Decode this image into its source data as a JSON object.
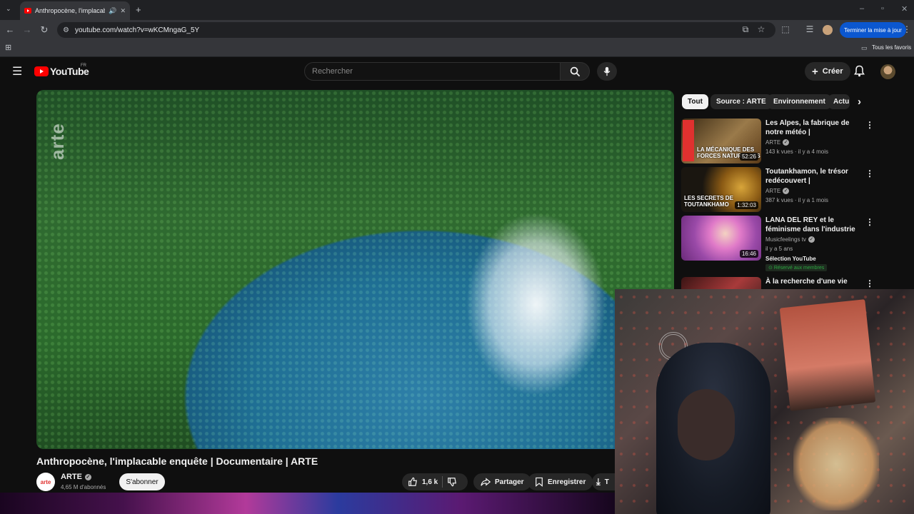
{
  "browser": {
    "tab_title": "Anthropocène, l'implacable",
    "url": "youtube.com/watch?v=wKCMngaG_5Y",
    "update_button": "Terminer la mise à jour",
    "bookmarks_label": "Tous les favoris"
  },
  "header": {
    "logo_text": "YouTube",
    "region": "FR",
    "search_placeholder": "Rechercher",
    "create_label": "Créer"
  },
  "video": {
    "watermark": "arte",
    "title": "Anthropocène, l'implacable enquête | Documentaire | ARTE",
    "channel_logo": "arte",
    "channel": "ARTE",
    "subscribers": "4,65 M d'abonnés",
    "subscribe": "S'abonner",
    "likes": "1,6 k",
    "share": "Partager",
    "save": "Enregistrer",
    "download_partial": "T"
  },
  "chips": [
    "Tout",
    "Source : ARTE",
    "Environnement",
    "Actu"
  ],
  "recommendations": [
    {
      "title": "Les Alpes, la fabrique de notre météo | Documentaire | ARTE",
      "channel": "ARTE",
      "meta": "143 k vues · il y a 4 mois",
      "duration": "52:26",
      "thumb_caption": "LA MÉCANIQUE DES FORCES NATURELLES",
      "thumb_color": "#7a5a2a"
    },
    {
      "title": "Toutankhamon, le trésor redécouvert | Documentaire ...",
      "channel": "ARTE",
      "meta": "387 k vues · il y a 1 mois",
      "duration": "1:32:03",
      "thumb_caption": "LES SECRETS DE TOUTANKHAMO",
      "thumb_color": "#2a2416"
    },
    {
      "title": "LANA DEL REY et le féminisme dans l'industrie du disque.",
      "channel": "Musicfeelings tv",
      "meta": "il y a 5 ans",
      "duration": "16:46",
      "extra1": "Sélection YouTube",
      "extra2": "Réservé aux membres",
      "thumb_caption": "",
      "thumb_color": "#c78ad0"
    },
    {
      "title": "À la recherche d'une vie",
      "channel": "",
      "meta": "",
      "duration": "",
      "thumb_caption": "",
      "thumb_color": "#5a1a1a"
    }
  ]
}
